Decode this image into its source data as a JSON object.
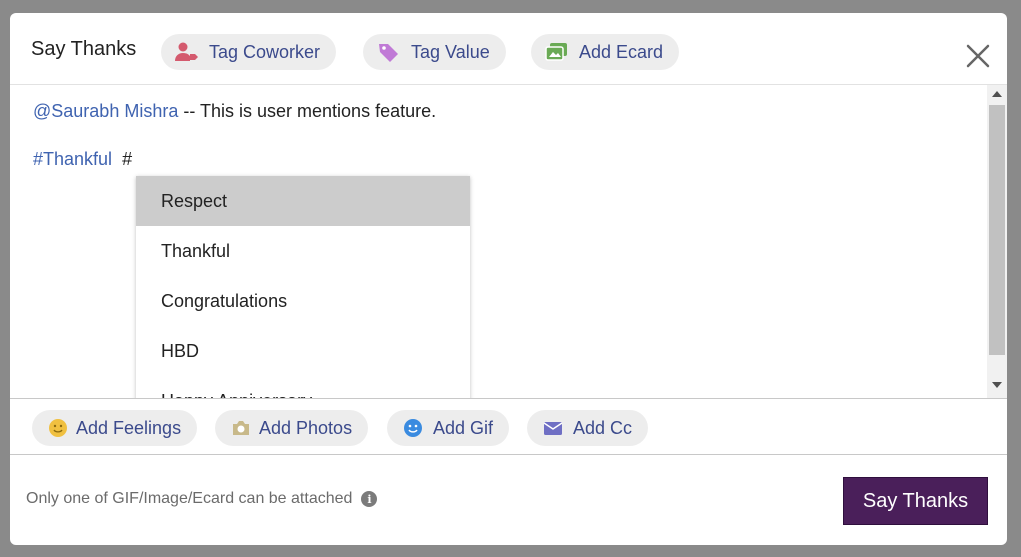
{
  "header": {
    "title": "Say Thanks",
    "tag_coworker": "Tag Coworker",
    "tag_value": "Tag Value",
    "add_ecard": "Add Ecard"
  },
  "editor": {
    "mention": "@Saurabh Mishra",
    "mention_text": " -- This is user mentions feature.",
    "hashtag": "#Thankful",
    "hash_input": "#"
  },
  "dropdown": {
    "items": [
      "Respect",
      "Thankful",
      "Congratulations",
      "HBD",
      "Happy Anniversary"
    ],
    "active_index": 0
  },
  "toolbar": {
    "add_feelings": "Add Feelings",
    "add_photos": "Add Photos",
    "add_gif": "Add Gif",
    "add_cc": "Add Cc"
  },
  "footer": {
    "note": "Only one of GIF/Image/Ecard can be attached",
    "submit": "Say Thanks"
  },
  "colors": {
    "accent": "#3b4a8c",
    "submit_bg": "#4a1f5a",
    "coworker_icon": "#d45a6e",
    "value_icon": "#c07ad6",
    "ecard_icon": "#6aaa55",
    "feelings_icon": "#f0c040",
    "photos_icon": "#c8b98a",
    "gif_icon": "#3a8be0",
    "cc_icon": "#6f6fc4"
  },
  "icons": [
    "user-tag-icon",
    "tag-icon",
    "images-icon",
    "close-icon",
    "smile-icon",
    "camera-icon",
    "gif-smile-icon",
    "envelope-icon",
    "info-icon"
  ]
}
